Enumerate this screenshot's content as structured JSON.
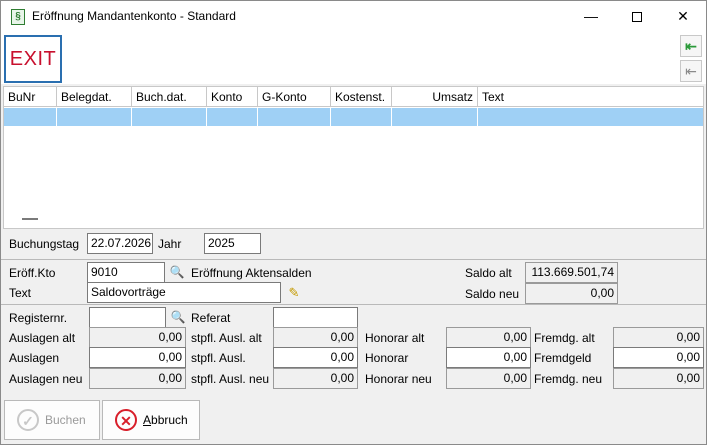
{
  "window": {
    "title": "Eröffnung Mandantenkonto - Standard",
    "icon_name": "app-icon",
    "minimize_glyph": "—",
    "close_glyph": "✕"
  },
  "toolbar": {
    "exit_label": "EXIT",
    "nav_first_icon": "arrow-left-to-bar-icon",
    "nav_prev_icon": "arrow-left-bar-icon",
    "nav_first_glyph": "⇤",
    "nav_prev_glyph": "⇤"
  },
  "grid": {
    "columns": [
      "BuNr",
      "Belegdat.",
      "Buch.dat.",
      "Konto",
      "G-Konto",
      "Kostenst.",
      "Umsatz",
      "Text"
    ],
    "selection_color": "#9fd0f5"
  },
  "booking": {
    "buchungstag_label": "Buchungstag",
    "buchungstag_value": "22.07.2026",
    "jahr_label": "Jahr",
    "jahr_value": "2025"
  },
  "account": {
    "eroeff_kto_label": "Eröff.Kto",
    "eroeff_kto_value": "9010",
    "eroeff_kto_desc": "Eröffnung Aktensalden",
    "text_label": "Text",
    "text_value": "Saldovorträge",
    "saldo_alt_label": "Saldo alt",
    "saldo_alt_value": "113.669.501,74",
    "saldo_neu_label": "Saldo neu",
    "saldo_neu_value": "0,00"
  },
  "details": {
    "registernr_label": "Registernr.",
    "registernr_value": "",
    "referat_label": "Referat",
    "referat_value": "",
    "rows": [
      {
        "c1_label": "Auslagen alt",
        "c1_value": "0,00",
        "c2_label": "stpfl. Ausl. alt",
        "c2_value": "0,00",
        "c3_label": "Honorar alt",
        "c3_value": "0,00",
        "c4_label": "Fremdg. alt",
        "c4_value": "0,00"
      },
      {
        "c1_label": "Auslagen",
        "c1_value": "0,00",
        "c2_label": "stpfl. Ausl.",
        "c2_value": "0,00",
        "c3_label": "Honorar",
        "c3_value": "0,00",
        "c4_label": "Fremdgeld",
        "c4_value": "0,00"
      },
      {
        "c1_label": "Auslagen neu",
        "c1_value": "0,00",
        "c2_label": "stpfl. Ausl. neu",
        "c2_value": "0,00",
        "c3_label": "Honorar neu",
        "c3_value": "0,00",
        "c4_label": "Fremdg. neu",
        "c4_value": "0,00"
      }
    ]
  },
  "buttons": {
    "buchen_label": "Buchen",
    "abbruch_prefix": "A",
    "abbruch_rest": "bbruch"
  },
  "colors": {
    "exit_text": "#c8102e",
    "exit_border": "#2a6fb0",
    "cancel_red": "#d81e2a",
    "nav_green": "#2b9a3a"
  }
}
